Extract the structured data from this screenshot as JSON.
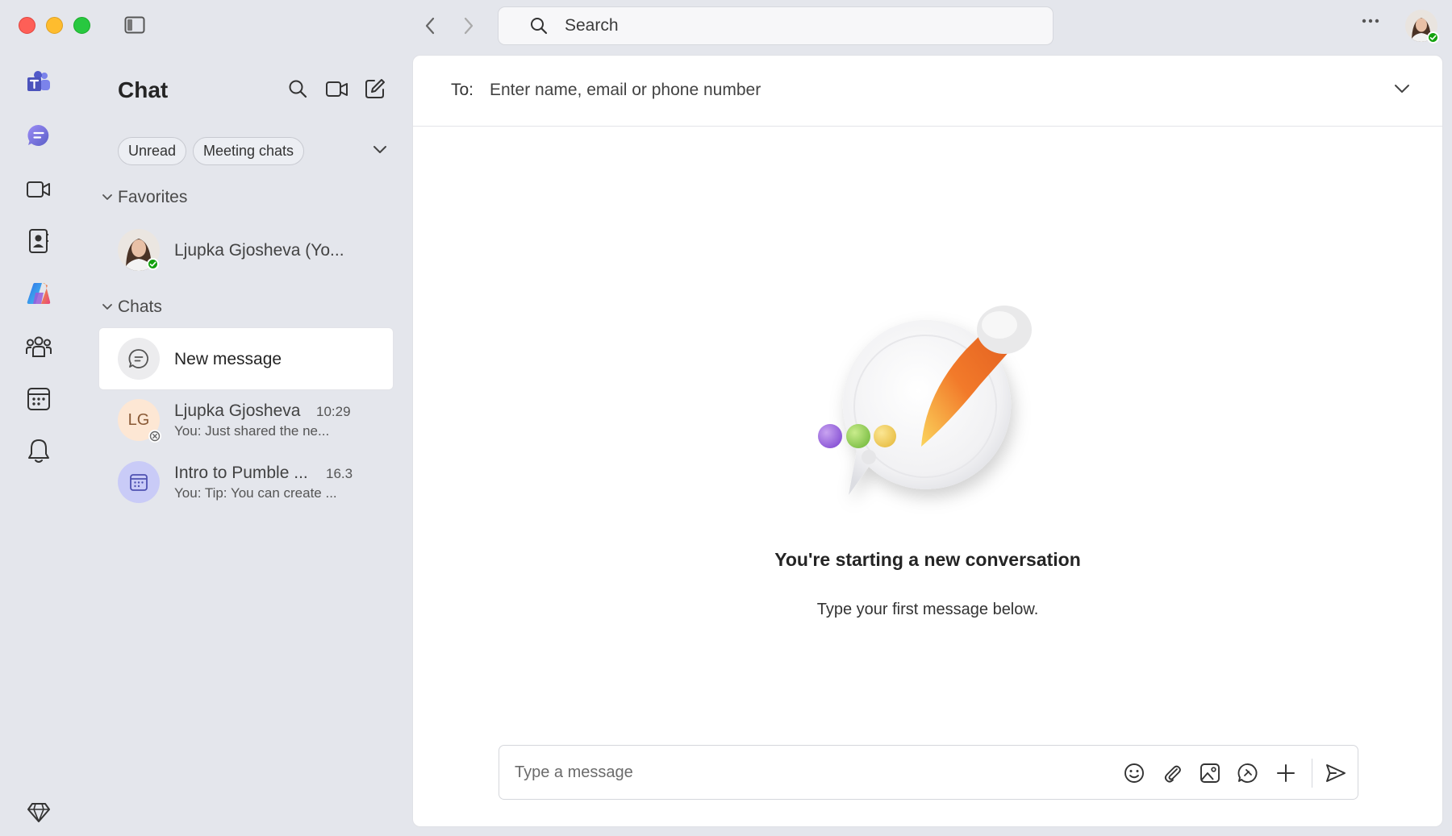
{
  "titlebar": {
    "search_placeholder": "Search"
  },
  "chat_panel": {
    "title": "Chat",
    "filters": [
      "Unread",
      "Meeting chats"
    ],
    "sections": {
      "favorites_label": "Favorites",
      "chats_label": "Chats"
    },
    "favorites": [
      {
        "name": "Ljupka Gjosheva (Yo...",
        "presence": "available"
      }
    ],
    "new_message_label": "New message",
    "chats": [
      {
        "initials": "LG",
        "name": "Ljupka Gjosheva",
        "time": "10:29",
        "preview": "You: Just shared the ne..."
      },
      {
        "name": "Intro to Pumble ...",
        "time": "16.3",
        "preview": "You: Tip: You can create ..."
      }
    ]
  },
  "main": {
    "to_label": "To:",
    "to_placeholder": "Enter name, email or phone number",
    "headline": "You're starting a new conversation",
    "subline": "Type your first message below.",
    "composer_placeholder": "Type a message"
  },
  "colors": {
    "accent": "#5b5fc7",
    "presence_green": "#13a10e",
    "lg_avatar_bg": "#fde7d4",
    "lg_avatar_text": "#8a5a36",
    "pumble_avatar_bg": "#c9cbf7"
  },
  "icons": {
    "rail": [
      "teams-logo-icon",
      "chat-icon",
      "video-icon",
      "contacts-icon",
      "copilot-icon",
      "communities-icon",
      "calendar-icon",
      "bell-icon",
      "premium-diamond-icon"
    ],
    "header": [
      "search-icon",
      "meet-now-icon",
      "compose-icon"
    ],
    "composer": [
      "emoji-icon",
      "attach-icon",
      "image-icon",
      "loop-icon",
      "plus-icon",
      "send-icon"
    ]
  }
}
